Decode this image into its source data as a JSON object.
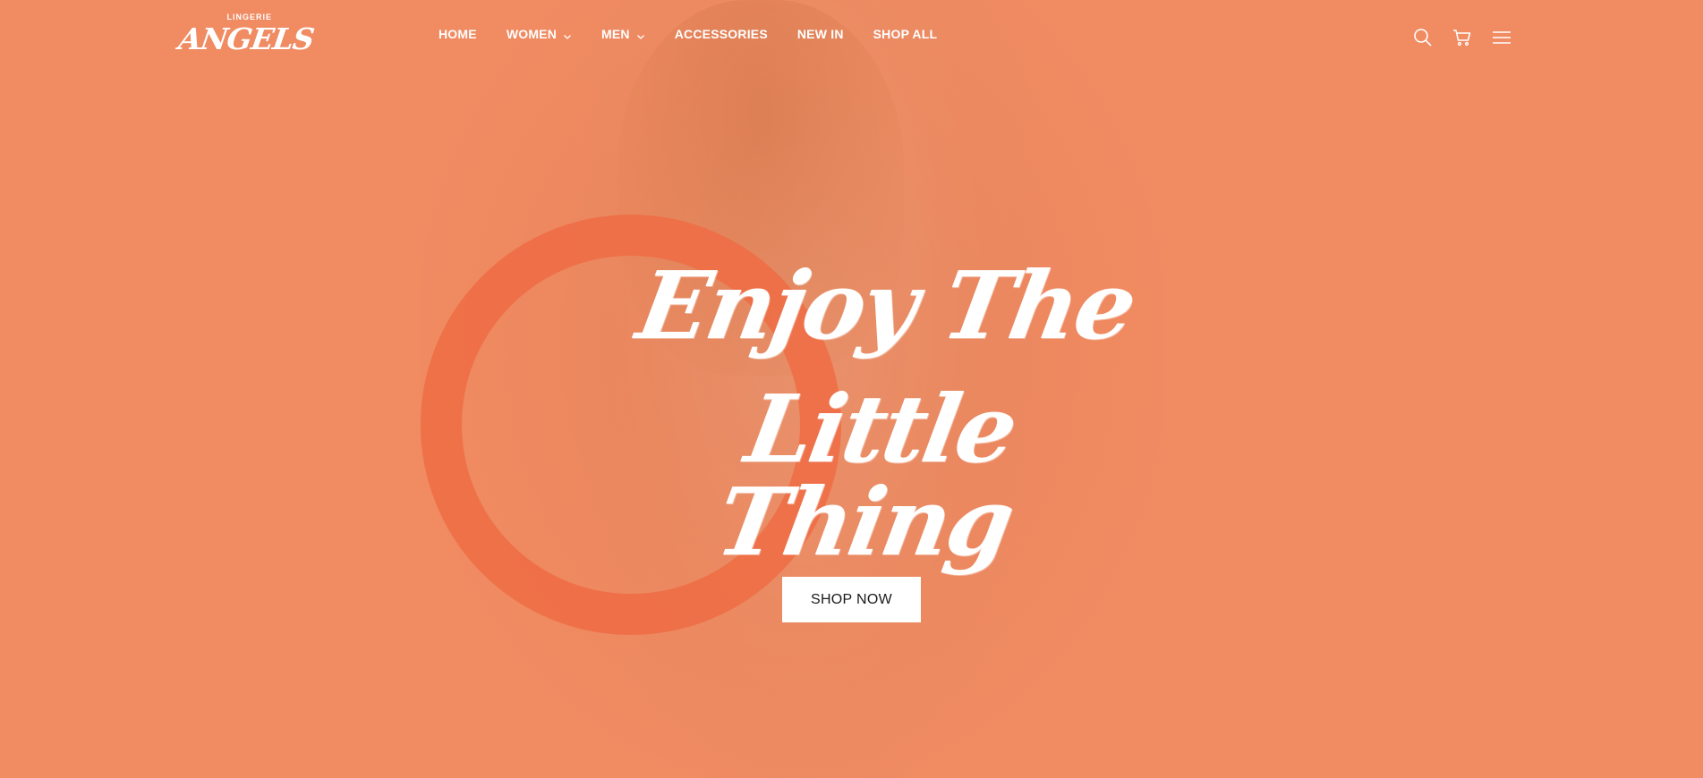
{
  "brand": {
    "sub": "LINGERIE",
    "name": "ANGELS"
  },
  "nav": {
    "items": [
      {
        "label": "HOME",
        "dropdown": false
      },
      {
        "label": "WOMEN",
        "dropdown": true
      },
      {
        "label": "MEN",
        "dropdown": true
      },
      {
        "label": "ACCESSORIES",
        "dropdown": false
      },
      {
        "label": "NEW IN",
        "dropdown": false
      },
      {
        "label": "SHOP ALL",
        "dropdown": false
      }
    ],
    "icons": [
      "search-icon",
      "cart-icon",
      "menu-icon"
    ]
  },
  "hero": {
    "headline_line1": "Enjoy The",
    "headline_line2": "Little Thing",
    "cta_label": "SHOP NOW"
  },
  "colors": {
    "background": "#F08B62",
    "ring": "#EE6C44",
    "text": "#FFFFFF",
    "button_bg": "#FFFFFF",
    "button_text": "#1A1A1A"
  }
}
